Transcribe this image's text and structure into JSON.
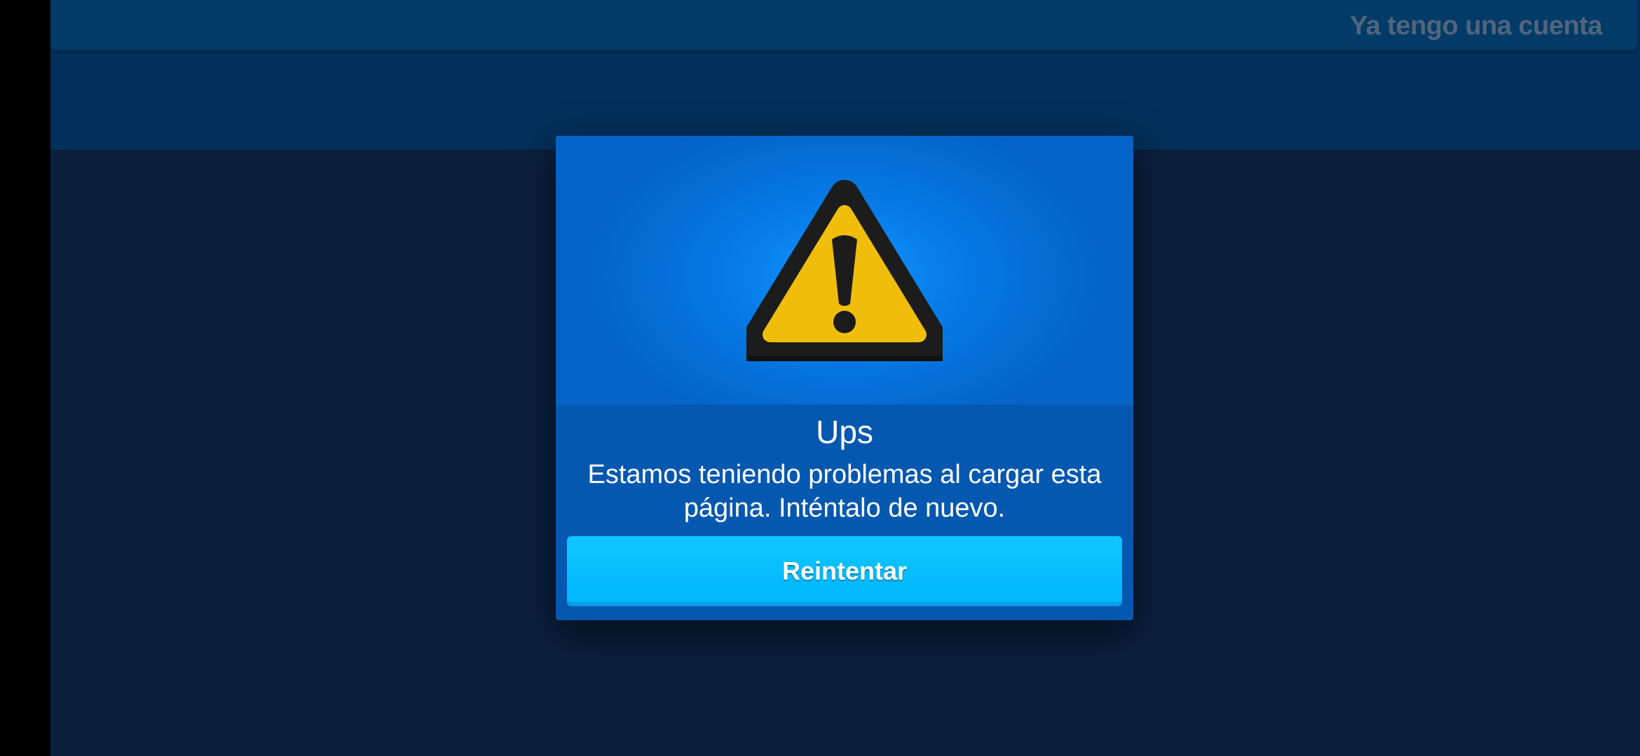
{
  "header": {
    "login_link": "Ya tengo una cuenta"
  },
  "dialog": {
    "icon": "warning-triangle-icon",
    "title": "Ups",
    "message": "Estamos teniendo problemas al cargar esta página. Inténtalo de nuevo.",
    "retry_label": "Reintentar"
  },
  "colors": {
    "background": "#0b1f3d",
    "header": "#023b67",
    "dialog": "#0558b0",
    "button": "#00b6ff",
    "warning_yellow": "#f0be0a"
  }
}
